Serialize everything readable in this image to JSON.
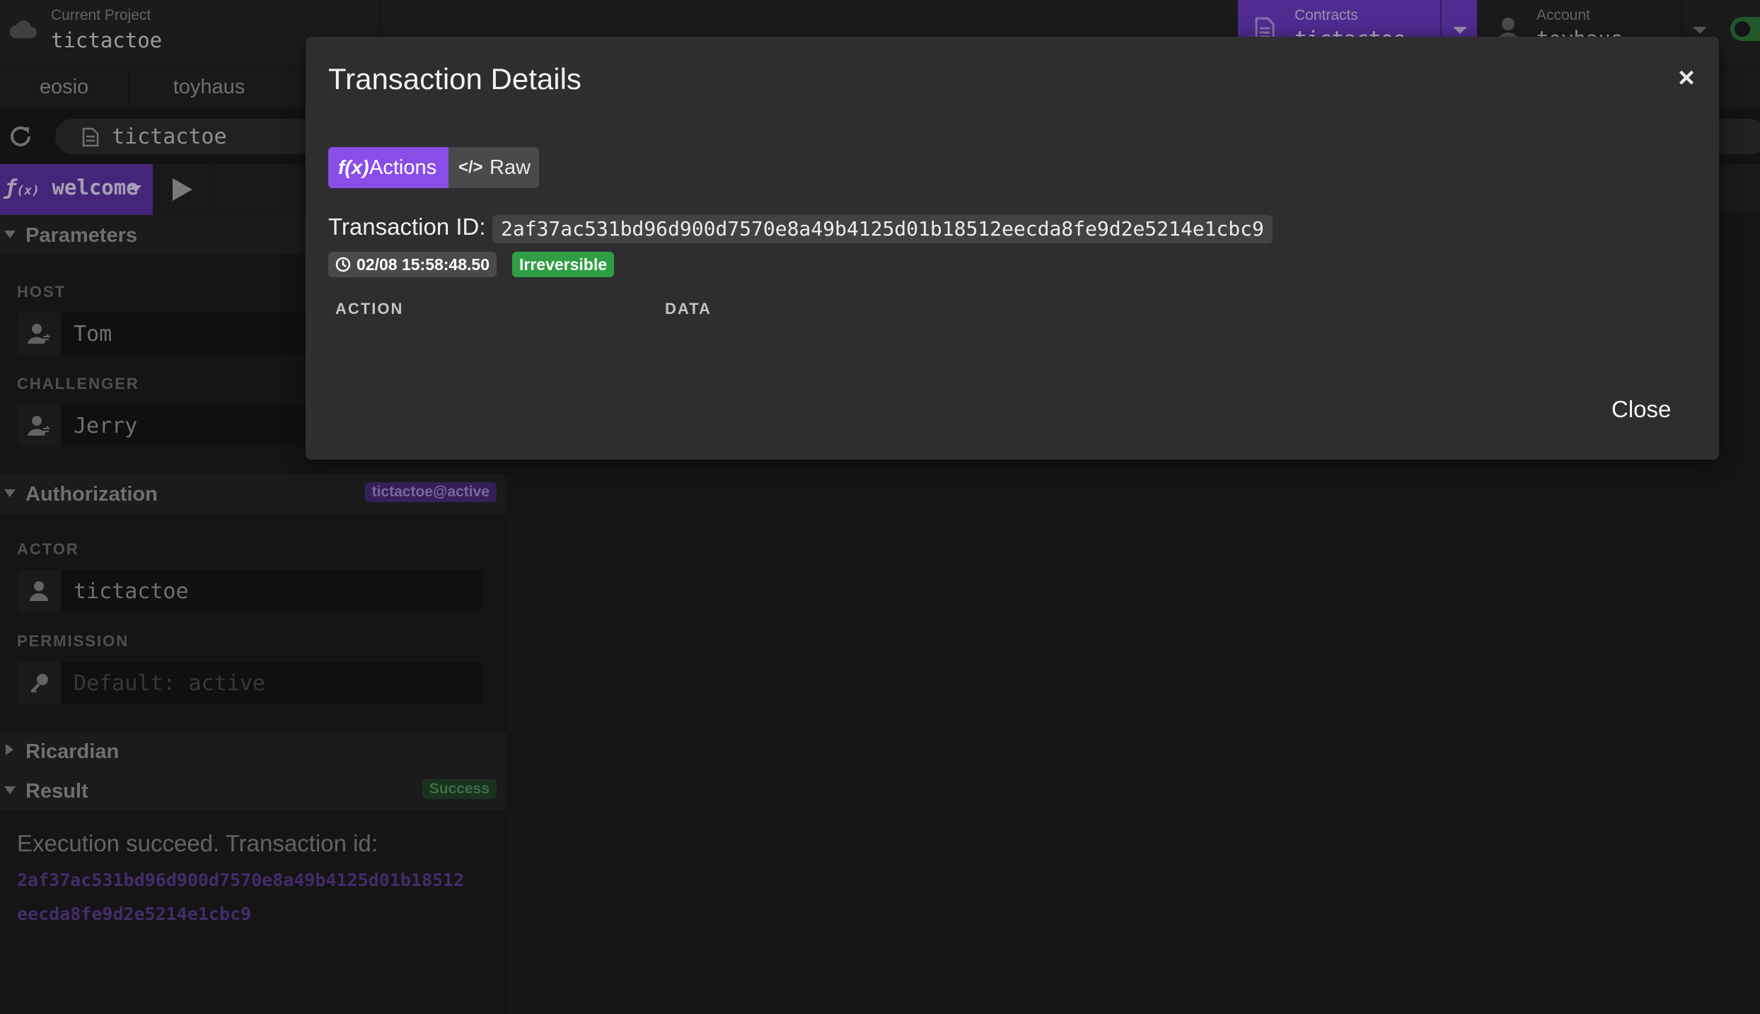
{
  "topbar": {
    "project_label": "Current Project",
    "project_name": "tictactoe",
    "contracts_label": "Contracts",
    "contracts_value": "tictactoe",
    "account_label": "Account",
    "account_value": "toyhaus"
  },
  "tabs": [
    {
      "label": "eosio"
    },
    {
      "label": "toyhaus"
    }
  ],
  "address": {
    "value": "tictactoe"
  },
  "action": {
    "function": "welcome"
  },
  "sections": {
    "parameters": {
      "title": "Parameters",
      "fields": [
        {
          "label": "HOST",
          "value": "Tom"
        },
        {
          "label": "CHALLENGER",
          "value": "Jerry"
        }
      ]
    },
    "authorization": {
      "title": "Authorization",
      "badge": "tictactoe@active",
      "actor_label": "ACTOR",
      "actor_value": "tictactoe",
      "permission_label": "PERMISSION",
      "permission_placeholder": "Default: active"
    },
    "ricardian": {
      "title": "Ricardian"
    },
    "result": {
      "title": "Result",
      "badge": "Success",
      "message": "Execution succeed. Transaction id:",
      "tx_line1": "2af37ac531bd96d900d7570e8a49b4125d01b18512",
      "tx_line2": "eecda8fe9d2e5214e1cbc9"
    }
  },
  "modal": {
    "title": "Transaction Details",
    "tab_actions": "Actions",
    "tab_actions_icon": "f(x)",
    "tab_raw": "Raw",
    "tab_raw_icon": "</>",
    "tx_label": "Transaction ID:",
    "tx_id": "2af37ac531bd96d900d7570e8a49b4125d01b18512eecda8fe9d2e5214e1cbc9",
    "timestamp": "02/08 15:58:48.50",
    "status": "Irreversible",
    "col_action": "ACTION",
    "col_data": "DATA",
    "close_label": "Close",
    "close_x": "×"
  },
  "colors": {
    "accent": "#8a4ee8",
    "status_green": "#2f9e44",
    "background": "#1e1e1f",
    "modal_bg": "#2e2e30"
  },
  "icons": [
    "cloud-icon",
    "contract-file-icon",
    "account-icon",
    "refresh-icon",
    "file-icon",
    "function-icon",
    "play-icon",
    "user-transfer-icon",
    "user-icon",
    "key-icon",
    "clock-icon",
    "code-icon",
    "close-icon",
    "chevron-down-icon"
  ]
}
